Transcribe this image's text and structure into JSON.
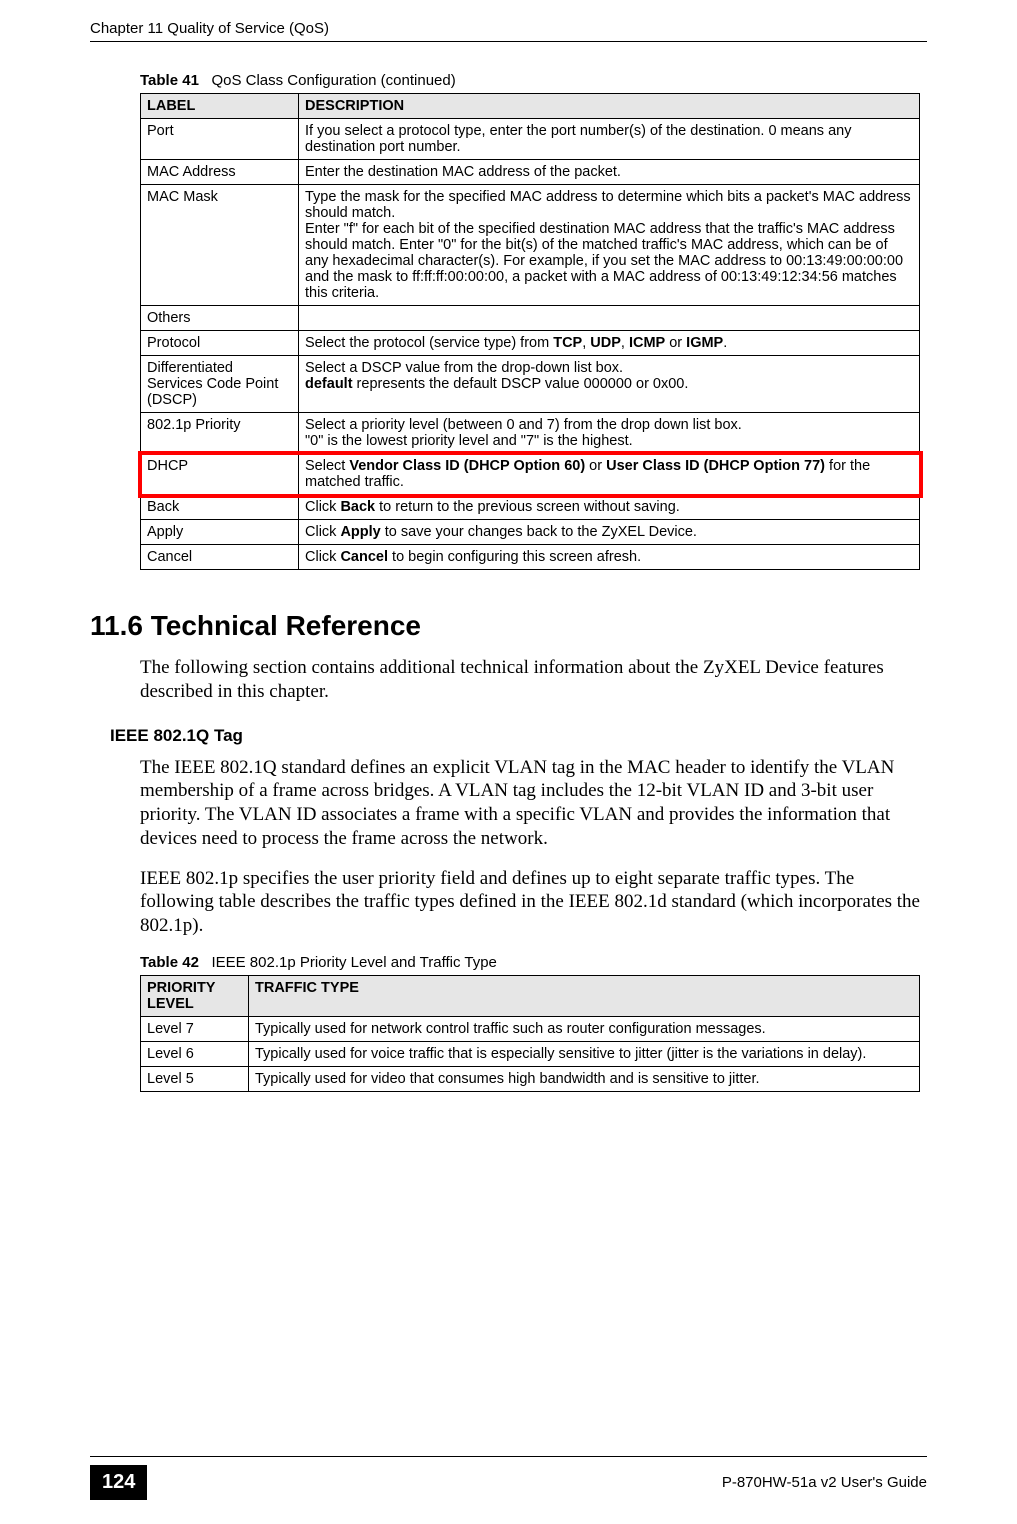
{
  "header": {
    "running": "Chapter 11 Quality of Service (QoS)"
  },
  "table41": {
    "caption_label": "Table 41",
    "caption_text": "QoS Class Configuration (continued)",
    "head": {
      "c1": "LABEL",
      "c2": "DESCRIPTION"
    },
    "rows": [
      {
        "label": "Port",
        "desc": "If you select a protocol type, enter the port number(s) of the destination. 0 means any destination port number."
      },
      {
        "label": "MAC Address",
        "desc": "Enter the destination MAC address of the packet."
      },
      {
        "label": "MAC Mask",
        "desc": "Type the mask for the specified MAC address to determine which bits a packet's MAC address should match.\nEnter \"f\" for each bit of the specified destination MAC address that the traffic's MAC address should match. Enter \"0\" for the bit(s) of the matched traffic's MAC address, which can be of any hexadecimal character(s). For example, if you set the MAC address to 00:13:49:00:00:00 and the mask to ff:ff:ff:00:00:00, a packet with a MAC address of 00:13:49:12:34:56 matches this criteria."
      },
      {
        "label": "Others",
        "desc": ""
      },
      {
        "label": "Protocol",
        "desc_pre": "Select the protocol (service type) from ",
        "b1": "TCP",
        "s1": ", ",
        "b2": "UDP",
        "s2": ", ",
        "b3": "ICMP",
        "s3": " or ",
        "b4": "IGMP",
        "s4": "."
      },
      {
        "label": "Differentiated Services Code Point (DSCP)",
        "desc_line1": "Select a DSCP value from the drop-down list box.",
        "b_default": "default",
        "desc_line2_rest": " represents the default DSCP value 000000 or 0x00."
      },
      {
        "label": "802.1p Priority",
        "desc": "Select a priority level (between 0 and 7) from the drop down list box.\n\"0\" is the lowest priority level and \"7\" is the highest."
      },
      {
        "label": "DHCP",
        "desc_pre": "Select ",
        "b1": "Vendor Class ID (DHCP Option 60)",
        "s1": " or ",
        "b2": "User Class ID (DHCP Option 77)",
        "s2": " for the matched traffic."
      },
      {
        "label": "Back",
        "desc_pre": "Click ",
        "b1": "Back",
        "s1": " to return to the previous screen without saving."
      },
      {
        "label": "Apply",
        "desc_pre": "Click ",
        "b1": "Apply",
        "s1": " to save your changes back to the ZyXEL Device."
      },
      {
        "label": "Cancel",
        "desc_pre": "Click ",
        "b1": "Cancel",
        "s1": " to begin configuring this screen afresh."
      }
    ]
  },
  "section": {
    "number_title": "11.6  Technical Reference",
    "intro": "The following section contains additional technical information about the ZyXEL Device features described in this chapter."
  },
  "ieee": {
    "heading": "IEEE 802.1Q Tag",
    "p1": "The IEEE 802.1Q standard defines an explicit VLAN tag in the MAC header to identify the VLAN membership of a frame across bridges. A VLAN tag includes the 12-bit VLAN ID and 3-bit user priority. The VLAN ID associates a frame with a specific VLAN and provides the information that devices need to process the frame across the network.",
    "p2": "IEEE 802.1p specifies the user priority field and defines up to eight separate traffic types. The following table describes the traffic types defined in the IEEE 802.1d standard (which incorporates the 802.1p)."
  },
  "table42": {
    "caption_label": "Table 42",
    "caption_text": "IEEE 802.1p Priority Level and Traffic Type",
    "head": {
      "c1": "PRIORITY LEVEL",
      "c2": "TRAFFIC TYPE"
    },
    "rows": [
      {
        "label": "Level 7",
        "desc": "Typically used for network control traffic such as router configuration messages."
      },
      {
        "label": "Level 6",
        "desc": "Typically used for voice traffic that is especially sensitive to jitter (jitter is the variations in delay)."
      },
      {
        "label": "Level 5",
        "desc": "Typically used for video that consumes high bandwidth and is sensitive to jitter."
      }
    ]
  },
  "footer": {
    "page_number": "124",
    "guide": "P-870HW-51a v2 User's Guide"
  },
  "highlight": {
    "color": "#ff0000"
  }
}
